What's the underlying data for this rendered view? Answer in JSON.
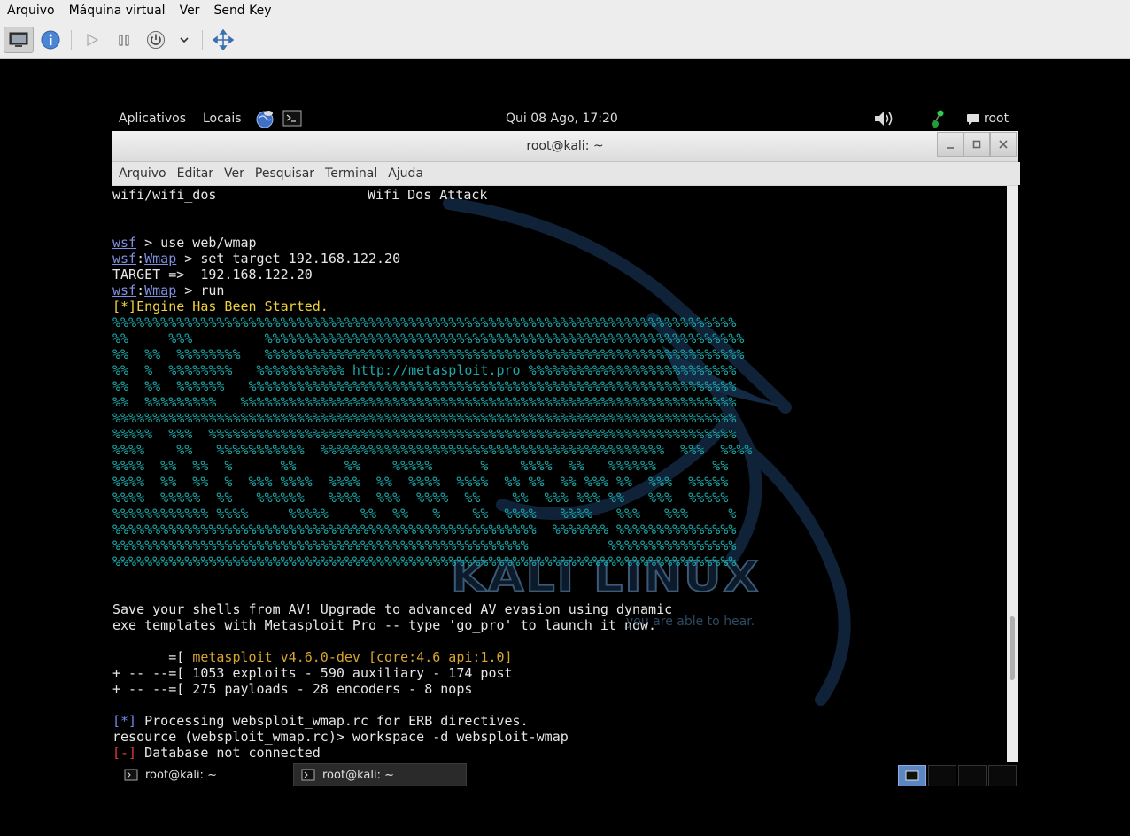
{
  "host": {
    "menu": [
      "Arquivo",
      "Máquina virtual",
      "Ver",
      "Send Key"
    ]
  },
  "guest_panel": {
    "applications": "Aplicativos",
    "places": "Locais",
    "clock": "Qui 08 Ago, 17:20",
    "user": "root"
  },
  "terminal": {
    "title": "root@kali: ~",
    "menu": [
      "Arquivo",
      "Editar",
      "Ver",
      "Pesquisar",
      "Terminal",
      "Ajuda"
    ],
    "lines": {
      "l0_left": "wifi/wifi_dos",
      "l0_right": "Wifi Dos Attack",
      "p1_prefix": "wsf",
      "p1_cmd": " > use web/wmap",
      "p2_prefix": "wsf",
      "p2_sep": ":",
      "p2_mod": "Wmap",
      "p2_cmd": " > set target 192.168.122.20",
      "target": "TARGET =>  192.168.122.20",
      "p3_prefix": "wsf",
      "p3_sep": ":",
      "p3_mod": "Wmap",
      "p3_cmd": " > run",
      "engine": "[*]Engine Has Been Started.",
      "banner": [
        "%%%%%%%%%%%%%%%%%%%%%%%%%%%%%%%%%%%%%%%%%%%%%%%%%%%%%%%%%%%%%%%%%%%%%%%%%%%%%%",
        "%%     %%%         %%%%%%%%%%%%%%%%%%%%%%%%%%%%%%%%%%%%%%%%%%%%%%%%%%%%%%%%%%%%",
        "%%  %%  %%%%%%%%   %%%%%%%%%%%%%%%%%%%%%%%%%%%%%%%%%%%%%%%%%%%%%%%%%%%%%%%%%%%%",
        "%%  %  %%%%%%%%   %%%%%%%%%%% http://metasploit.pro %%%%%%%%%%%%%%%%%%%%%%%%%%",
        "%%  %%  %%%%%%   %%%%%%%%%%%%%%%%%%%%%%%%%%%%%%%%%%%%%%%%%%%%%%%%%%%%%%%%%%%%%",
        "%%  %%%%%%%%%   %%%%%%%%%%%%%%%%%%%%%%%%%%%%%%%%%%%%%%%%%%%%%%%%%%%%%%%%%%%%%%",
        "%%%%%%%%%%%%%%%%%%%%%%%%%%%%%%%%%%%%%%%%%%%%%%%%%%%%%%%%%%%%%%%%%%%%%%%%%%%%%%",
        "%%%%%  %%%  %%%%%%%%%%%%%%%%%%%%%%%%%%%%%%%%%%%%%%%%%%%%%%%%%%%%%%%%%%%%%%%%%%",
        "%%%%    %%   %%%%%%%%%%%  %%%%%%%%%%%%%%%%%%%%%%%%%%%%%%%%%%%%%%%%%%%  %%%  %%%%",
        "%%%%  %%  %%  %      %%      %%    %%%%%      %    %%%%  %%   %%%%%%       %%",
        "%%%%  %%  %%  %  %%% %%%%  %%%%  %%  %%%%  %%%%  %% %%  %% %%% %%  %%%  %%%%%",
        "%%%%  %%%%%  %%   %%%%%%   %%%%  %%%  %%%%  %%    %%  %%% %%% %%   %%%  %%%%%",
        "%%%%%%%%%%%% %%%%     %%%%%    %%  %%   %    %%  %%%%   %%%%   %%%   %%%     %",
        "%%%%%%%%%%%%%%%%%%%%%%%%%%%%%%%%%%%%%%%%%%%%%%%%%%%%%  %%%%%%% %%%%%%%%%%%%%%%",
        "%%%%%%%%%%%%%%%%%%%%%%%%%%%%%%%%%%%%%%%%%%%%%%%%%%%%          %%%%%%%%%%%%%%%%",
        "%%%%%%%%%%%%%%%%%%%%%%%%%%%%%%%%%%%%%%%%%%%%%%%%%%%%%%%%%%%%%%%%%%%%%%%%%%%%%%"
      ],
      "save1": "Save your shells from AV! Upgrade to advanced AV evasion using dynamic",
      "save2": "exe templates with Metasploit Pro -- type 'go_pro' to launch it now.",
      "ver_prefix": "       =[ ",
      "ver": "metasploit v4.6.0-dev [core:4.6 api:1.0]",
      "exploits": "+ -- --=[ 1053 exploits - 590 auxiliary - 174 post",
      "payloads": "+ -- --=[ 275 payloads - 28 encoders - 8 nops",
      "proc_tag": "[*]",
      "proc": " Processing websploit_wmap.rc for ERB directives.",
      "resource": "resource (websploit_wmap.rc)> workspace -d websploit-wmap",
      "err_tag": "[-]",
      "err": " Database not connected"
    },
    "wallpaper": {
      "wordmark": "KALI LINUX",
      "tagline": "you are able to hear."
    }
  },
  "taskbar": {
    "items": [
      "root@kali: ~",
      "root@kali: ~"
    ]
  }
}
